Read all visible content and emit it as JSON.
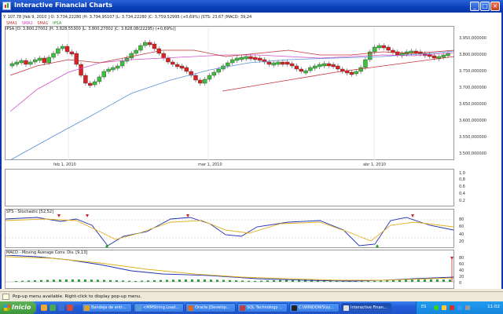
{
  "window": {
    "title": "Interactive Financial Charts",
    "icon": "chart-icon"
  },
  "controls": {
    "minimize": "_",
    "maximize": "□",
    "close": "×"
  },
  "info_row": "Y: 107.78 [feb 9, 2010 ] O: 3.734,22280 |H: 3.794,95107 |L: 3.734,22280 |C: 3.759,52995 (+0,69%) |STS: 23,67 |MACD: 39,24",
  "legend": [
    {
      "label": "SMA1",
      "color": "#c23030"
    },
    {
      "label": "SMA2",
      "color": "#d040c0"
    },
    {
      "label": "SMA1",
      "color": "#c23030"
    },
    {
      "label": "IPSA",
      "color": "#2a9a3a"
    }
  ],
  "ohlc_label": "IPSA [O: 3.800,27002 |H: 3.828,55300 |L: 3.800,27002 |C: 3.828,08(22295) (+0,69%)]",
  "price_panel": {
    "y_ticks": [
      "3.950,000000",
      "3.800,000000",
      "3.750,000000",
      "3.700,000000",
      "3.650,000000",
      "3.600,000000",
      "3.550,000000",
      "3.500,000000"
    ],
    "date_ticks": [
      "feb 1, 2010",
      "mar 1, 2010",
      "abr 1, 2010"
    ]
  },
  "empty_panel": {
    "y_ticks": [
      "1,0",
      "0,8",
      "0,6",
      "0,4",
      "0,2"
    ]
  },
  "sts_panel": {
    "label": "STS - Stochastic [52,52]",
    "y_ticks": [
      "80",
      "60",
      "40",
      "20"
    ]
  },
  "macd_panel": {
    "label": "MACD - Moving Average Conv. Div. [9,13]",
    "y_ticks": [
      "80",
      "60",
      "40",
      "20",
      "0"
    ]
  },
  "status": {
    "text": "Pop-up menu available. Right-click to display pop-up menu."
  },
  "taskbar": {
    "start": "Inicio",
    "tasks": [
      {
        "label": "Bandeja de entr...",
        "color": "#e0a030",
        "active": false
      },
      {
        "label": "<MMString.Load...",
        "color": "#5c9ad8",
        "active": false
      },
      {
        "label": "Oracle JDevelop...",
        "color": "#d86a30",
        "active": false
      },
      {
        "label": "SQL Technology ...",
        "color": "#c04040",
        "active": false
      },
      {
        "label": "C:\\WINDOWS\\sy...",
        "color": "#222222",
        "active": false
      },
      {
        "label": "Interactive Finan...",
        "color": "#e0e0e0",
        "active": true
      }
    ],
    "language": "ES",
    "clock": "11:02"
  }
}
